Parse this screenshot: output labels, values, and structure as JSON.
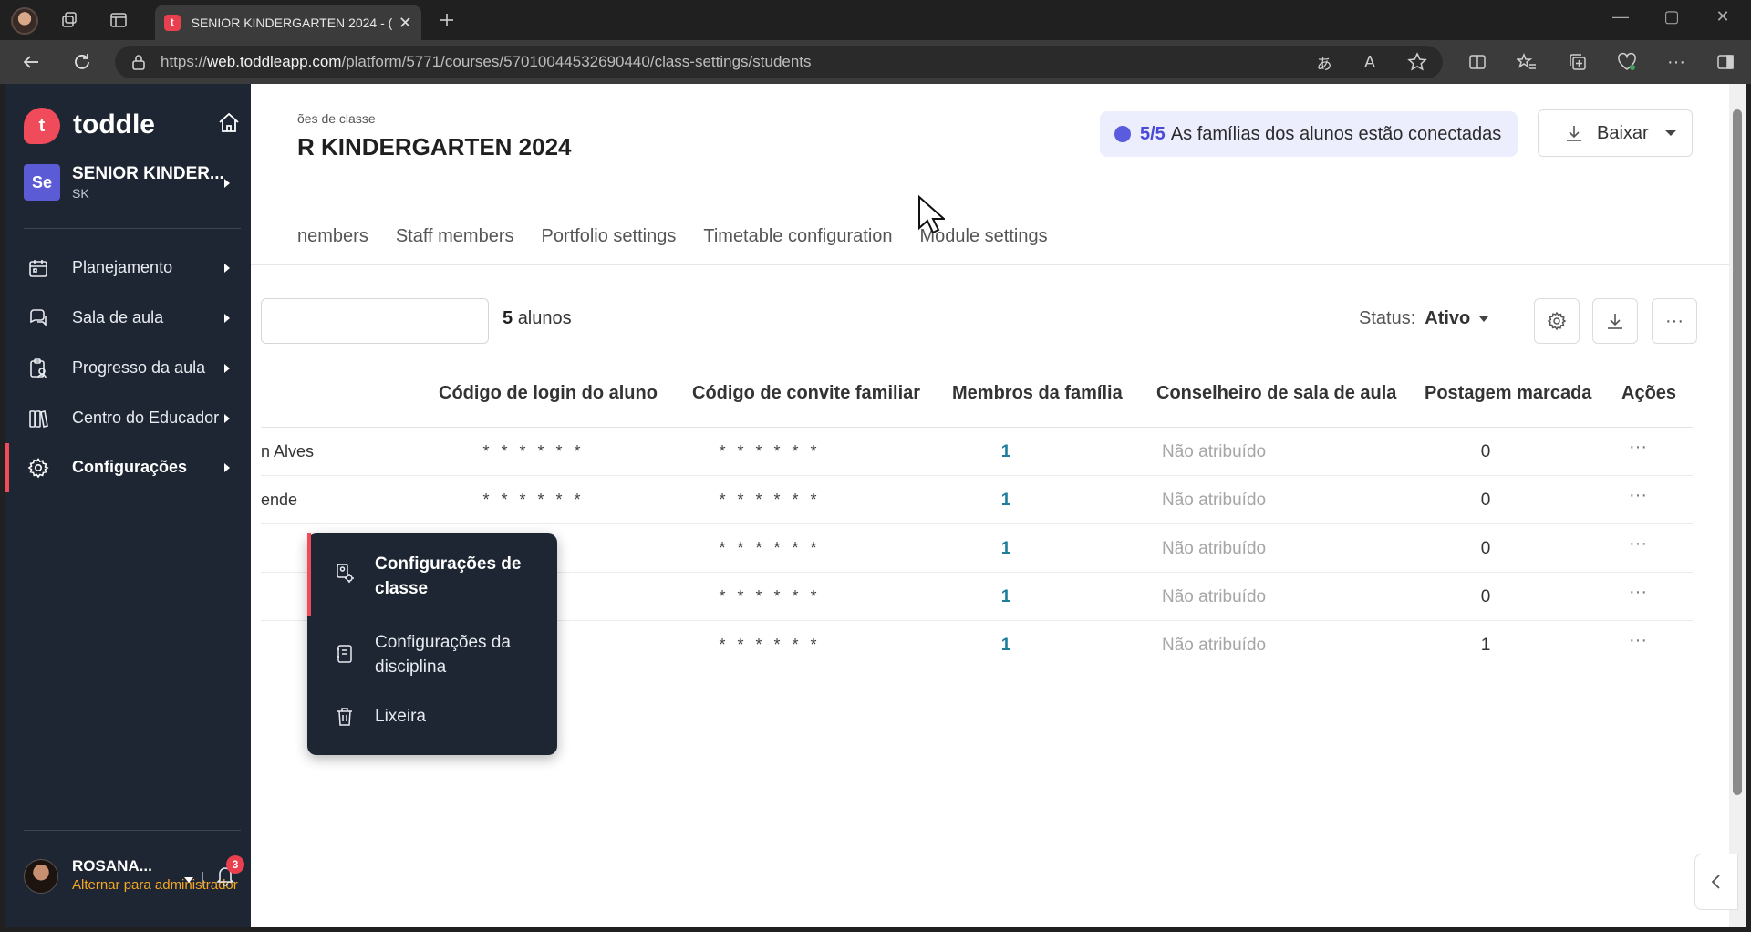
{
  "browser": {
    "tab_title": "SENIOR KINDERGARTEN 2024 - (",
    "tab_favicon": "t",
    "url_prefix": "https://",
    "url_host": "web.toddleapp.com",
    "url_path": "/platform/5771/courses/57010044532690440/class-settings/students"
  },
  "sidebar": {
    "brand": "toddle",
    "logo_letter": "t",
    "class": {
      "avatar": "Se",
      "name": "SENIOR KINDER...",
      "code": "SK"
    },
    "items": [
      {
        "label": "Planejamento",
        "icon": "calendar-icon"
      },
      {
        "label": "Sala de aula",
        "icon": "chat-bubbles-icon"
      },
      {
        "label": "Progresso da aula",
        "icon": "clipboard-person-icon"
      },
      {
        "label": "Centro do Educador",
        "icon": "books-icon"
      },
      {
        "label": "Configurações",
        "icon": "gear-icon",
        "active": true
      }
    ],
    "user": {
      "name": "ROSANA...",
      "switch_label": "Alternar para administrador",
      "notifications": "3"
    }
  },
  "submenu": {
    "items": [
      {
        "label": "Configurações de classe",
        "icon": "class-settings-icon",
        "active": true
      },
      {
        "label": "Configurações da disciplina",
        "icon": "notebook-icon"
      },
      {
        "label": "Lixeira",
        "icon": "trash-icon"
      }
    ]
  },
  "header": {
    "breadcrumb": "ões de classe",
    "title": "R KINDERGARTEN 2024",
    "families_count": "5/5",
    "families_text": "As famílias dos alunos estão conectadas",
    "download_label": "Baixar"
  },
  "tabs": [
    "nembers",
    "Staff members",
    "Portfolio settings",
    "Timetable configuration",
    "Module settings"
  ],
  "toolbar": {
    "student_count": "5",
    "student_label": "alunos",
    "status_label": "Status:",
    "status_value": "Ativo"
  },
  "table": {
    "columns": [
      "Código de login do aluno",
      "Código de convite familiar",
      "Membros da família",
      "Conselheiro de sala de aula",
      "Postagem marcada",
      "Ações"
    ],
    "rows": [
      {
        "name": "n Alves",
        "login": "* * * * * *",
        "invite": "* * * * * *",
        "family": "1",
        "advisor": "Não atribuído",
        "posts": "0",
        "actions": "···"
      },
      {
        "name": "ende",
        "login": "* * * * * *",
        "invite": "* * * * * *",
        "family": "1",
        "advisor": "Não atribuído",
        "posts": "0",
        "actions": "···"
      },
      {
        "name": "",
        "login": "* * *",
        "invite": "* * * * * *",
        "family": "1",
        "advisor": "Não atribuído",
        "posts": "0",
        "actions": "···"
      },
      {
        "name": "",
        "login": "* * *",
        "invite": "* * * * * *",
        "family": "1",
        "advisor": "Não atribuído",
        "posts": "0",
        "actions": "···"
      },
      {
        "name": "",
        "login": "* * *",
        "invite": "* * * * * *",
        "family": "1",
        "advisor": "Não atribuído",
        "posts": "1",
        "actions": "···"
      }
    ]
  },
  "colors": {
    "brand": "#f04b5a",
    "sidebar_bg": "#1e2633",
    "accent": "#5b5bd6",
    "link": "#1e7f9c"
  }
}
